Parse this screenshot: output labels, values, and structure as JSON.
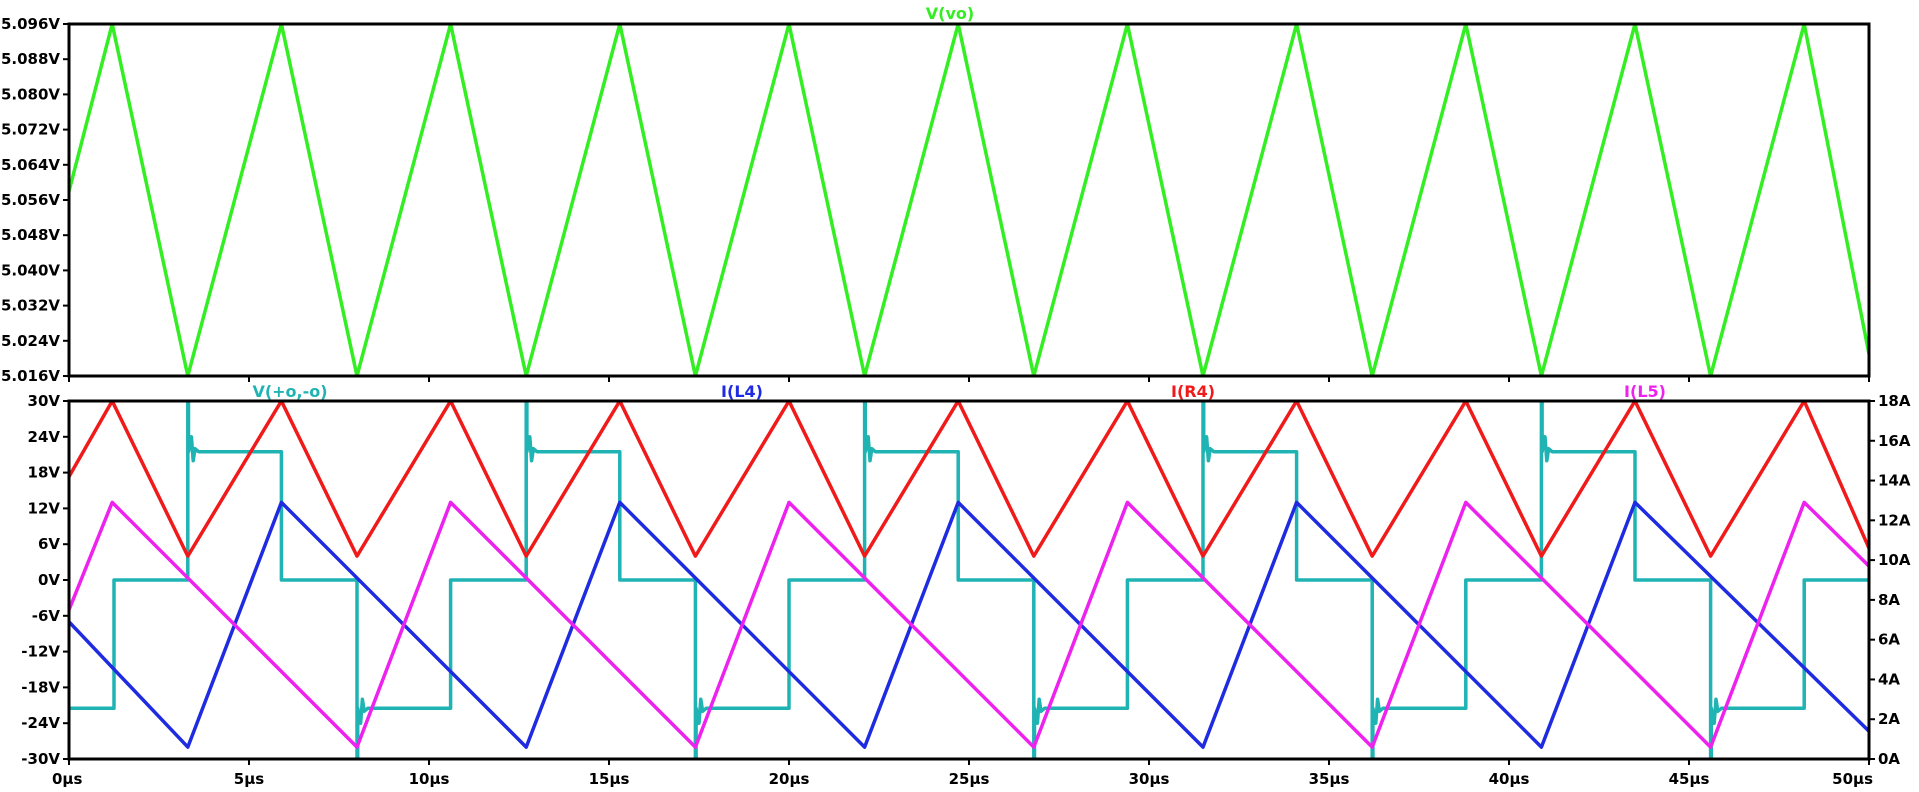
{
  "colors": {
    "vo": "#33ee22",
    "v_diff": "#1fb3b3",
    "i_l4": "#1f2be0",
    "i_r4": "#f01a1a",
    "i_l5": "#ee22ee",
    "frame": "#000000"
  },
  "chart_data": [
    {
      "type": "line",
      "title": "",
      "xlabel": "",
      "ylabel": "",
      "xlim": [
        0,
        50
      ],
      "ylim": [
        5.016,
        5.096
      ],
      "grid": false,
      "legend": "top-center",
      "x_unit": "µs",
      "x_ticks": [
        "0µs",
        "5µs",
        "10µs",
        "15µs",
        "20µs",
        "25µs",
        "30µs",
        "35µs",
        "40µs",
        "45µs",
        "50µs"
      ],
      "y_ticks": [
        "5.016V",
        "5.024V",
        "5.032V",
        "5.040V",
        "5.048V",
        "5.056V",
        "5.064V",
        "5.072V",
        "5.080V",
        "5.088V",
        "5.096V"
      ],
      "series": [
        {
          "name": "V(vo)",
          "color_key": "vo",
          "x": [
            0,
            1.2,
            3.3,
            5.9,
            8.0,
            10.6,
            12.7,
            15.3,
            17.4,
            20.0,
            22.1,
            24.7,
            26.8,
            29.4,
            31.5,
            34.1,
            36.2,
            38.8,
            40.9,
            43.5,
            45.6,
            48.2,
            50.0
          ],
          "y": [
            5.058,
            5.096,
            5.016,
            5.096,
            5.016,
            5.096,
            5.016,
            5.096,
            5.016,
            5.096,
            5.016,
            5.096,
            5.016,
            5.096,
            5.016,
            5.096,
            5.016,
            5.096,
            5.016,
            5.096,
            5.016,
            5.096,
            5.021
          ]
        }
      ]
    },
    {
      "type": "line",
      "title": "",
      "xlabel": "",
      "ylabel": "",
      "xlim": [
        0,
        50
      ],
      "ylim_left": [
        -30,
        30
      ],
      "ylim_right": [
        0,
        18
      ],
      "grid": false,
      "legend": "top",
      "x_ticks": [
        "0µs",
        "5µs",
        "10µs",
        "15µs",
        "20µs",
        "25µs",
        "30µs",
        "35µs",
        "40µs",
        "45µs",
        "50µs"
      ],
      "y_ticks_left": [
        "-30V",
        "-24V",
        "-18V",
        "-12V",
        "-6V",
        "0V",
        "6V",
        "12V",
        "18V",
        "24V",
        "30V"
      ],
      "y_ticks_right": [
        "0A",
        "2A",
        "4A",
        "6A",
        "8A",
        "10A",
        "12A",
        "14A",
        "16A",
        "18A"
      ],
      "series": [
        {
          "name": "V(+o,-o)",
          "axis": "left",
          "color_key": "v_diff",
          "x": [
            0,
            1.25,
            1.25,
            3.3,
            3.3,
            3.32,
            3.32,
            3.4,
            3.45,
            3.5,
            3.6,
            5.9,
            5.9,
            8.0,
            8.0,
            8.02,
            8.02,
            8.1,
            8.15,
            8.2,
            8.3,
            10.6,
            10.6,
            12.7,
            12.7,
            12.72,
            12.72,
            12.8,
            12.85,
            12.9,
            13.0,
            15.3,
            15.3,
            17.4,
            17.4,
            17.42,
            17.42,
            17.5,
            17.55,
            17.6,
            17.7,
            20.0,
            20.0,
            22.1,
            22.1,
            22.12,
            22.12,
            22.2,
            22.25,
            22.3,
            22.4,
            24.7,
            24.7,
            26.8,
            26.8,
            26.82,
            26.82,
            26.9,
            26.95,
            27.0,
            27.1,
            29.4,
            29.4,
            31.5,
            31.5,
            31.52,
            31.52,
            31.6,
            31.65,
            31.7,
            31.8,
            34.1,
            34.1,
            36.2,
            36.2,
            36.22,
            36.22,
            36.3,
            36.35,
            36.4,
            36.5,
            38.8,
            38.8,
            40.9,
            40.9,
            40.92,
            40.92,
            41.0,
            41.05,
            41.1,
            41.2,
            43.5,
            43.5,
            45.6,
            45.6,
            45.62,
            45.62,
            45.7,
            45.75,
            45.8,
            45.9,
            48.2,
            48.2,
            50.0
          ],
          "y": [
            -21.5,
            -21.5,
            0,
            0,
            30,
            30,
            21.5,
            24,
            20,
            22,
            21.5,
            21.5,
            0,
            0,
            -30,
            -30,
            -21.5,
            -24,
            -20,
            -22,
            -21.5,
            -21.5,
            0,
            0,
            30,
            30,
            21.5,
            24,
            20,
            22,
            21.5,
            21.5,
            0,
            0,
            -30,
            -30,
            -21.5,
            -24,
            -20,
            -22,
            -21.5,
            -21.5,
            0,
            0,
            30,
            30,
            21.5,
            24,
            20,
            22,
            21.5,
            21.5,
            0,
            0,
            -30,
            -30,
            -21.5,
            -24,
            -20,
            -22,
            -21.5,
            -21.5,
            0,
            0,
            30,
            30,
            21.5,
            24,
            20,
            22,
            21.5,
            21.5,
            0,
            0,
            -30,
            -30,
            -21.5,
            -24,
            -20,
            -22,
            -21.5,
            -21.5,
            0,
            0,
            30,
            30,
            21.5,
            24,
            20,
            22,
            21.5,
            21.5,
            0,
            0,
            -30,
            -30,
            -21.5,
            -24,
            -20,
            -22,
            -21.5,
            -21.5,
            0,
            0
          ]
        },
        {
          "name": "I(L4)",
          "axis": "right",
          "color_key": "i_l4",
          "x": [
            0,
            3.3,
            5.9,
            12.7,
            15.3,
            22.1,
            24.7,
            31.5,
            34.1,
            40.9,
            43.5,
            50.0
          ],
          "y": [
            6.9,
            0.6,
            12.9,
            0.6,
            12.9,
            0.6,
            12.9,
            0.6,
            12.9,
            0.6,
            12.9,
            1.4
          ]
        },
        {
          "name": "I(R4)",
          "axis": "right",
          "color_key": "i_r4",
          "x": [
            0,
            1.2,
            3.3,
            5.9,
            8.0,
            10.6,
            12.7,
            15.3,
            17.4,
            20.0,
            22.1,
            24.7,
            26.8,
            29.4,
            31.5,
            34.1,
            36.2,
            38.8,
            40.9,
            43.5,
            45.6,
            48.2,
            50.0
          ],
          "y": [
            14.2,
            18.0,
            10.2,
            18.0,
            10.2,
            18.0,
            10.2,
            18.0,
            10.2,
            18.0,
            10.2,
            18.0,
            10.2,
            18.0,
            10.2,
            18.0,
            10.2,
            18.0,
            10.2,
            18.0,
            10.2,
            18.0,
            10.6
          ]
        },
        {
          "name": "I(L5)",
          "axis": "right",
          "color_key": "i_l5",
          "x": [
            0,
            1.2,
            8.0,
            10.6,
            17.4,
            20.0,
            26.8,
            29.4,
            36.2,
            38.8,
            45.6,
            48.2,
            50.0
          ],
          "y": [
            7.5,
            12.9,
            0.6,
            12.9,
            0.6,
            12.9,
            0.6,
            12.9,
            0.6,
            12.9,
            0.6,
            12.9,
            9.7
          ]
        }
      ]
    }
  ]
}
